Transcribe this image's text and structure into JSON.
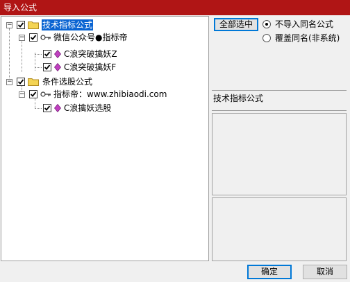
{
  "window": {
    "title": "导入公式"
  },
  "tree": {
    "nodes": [
      {
        "label": "技术指标公式",
        "checked": true,
        "selected": true
      },
      {
        "label": "微信公众号●指标帝",
        "checked": true
      },
      {
        "label": "C浪突破擒妖Z",
        "checked": true
      },
      {
        "label": "C浪突破擒妖F",
        "checked": true
      },
      {
        "label": "条件选股公式",
        "checked": true
      },
      {
        "label": "指标帝：www.zhibiaodi.com",
        "checked": true
      },
      {
        "label": "C浪擒妖选股",
        "checked": true
      }
    ]
  },
  "options": {
    "select_all": "全部选中",
    "radio_no_import": "不导入同名公式",
    "radio_overwrite": "覆盖同名(非系统)",
    "selected_radio": "no_import"
  },
  "info_panel": {
    "label": "技术指标公式"
  },
  "buttons": {
    "ok": "确定",
    "cancel": "取消"
  },
  "colors": {
    "titlebar": "#b01515",
    "selection": "#0a64d2",
    "gem": "#c040c0",
    "folder": "#f4d454"
  }
}
